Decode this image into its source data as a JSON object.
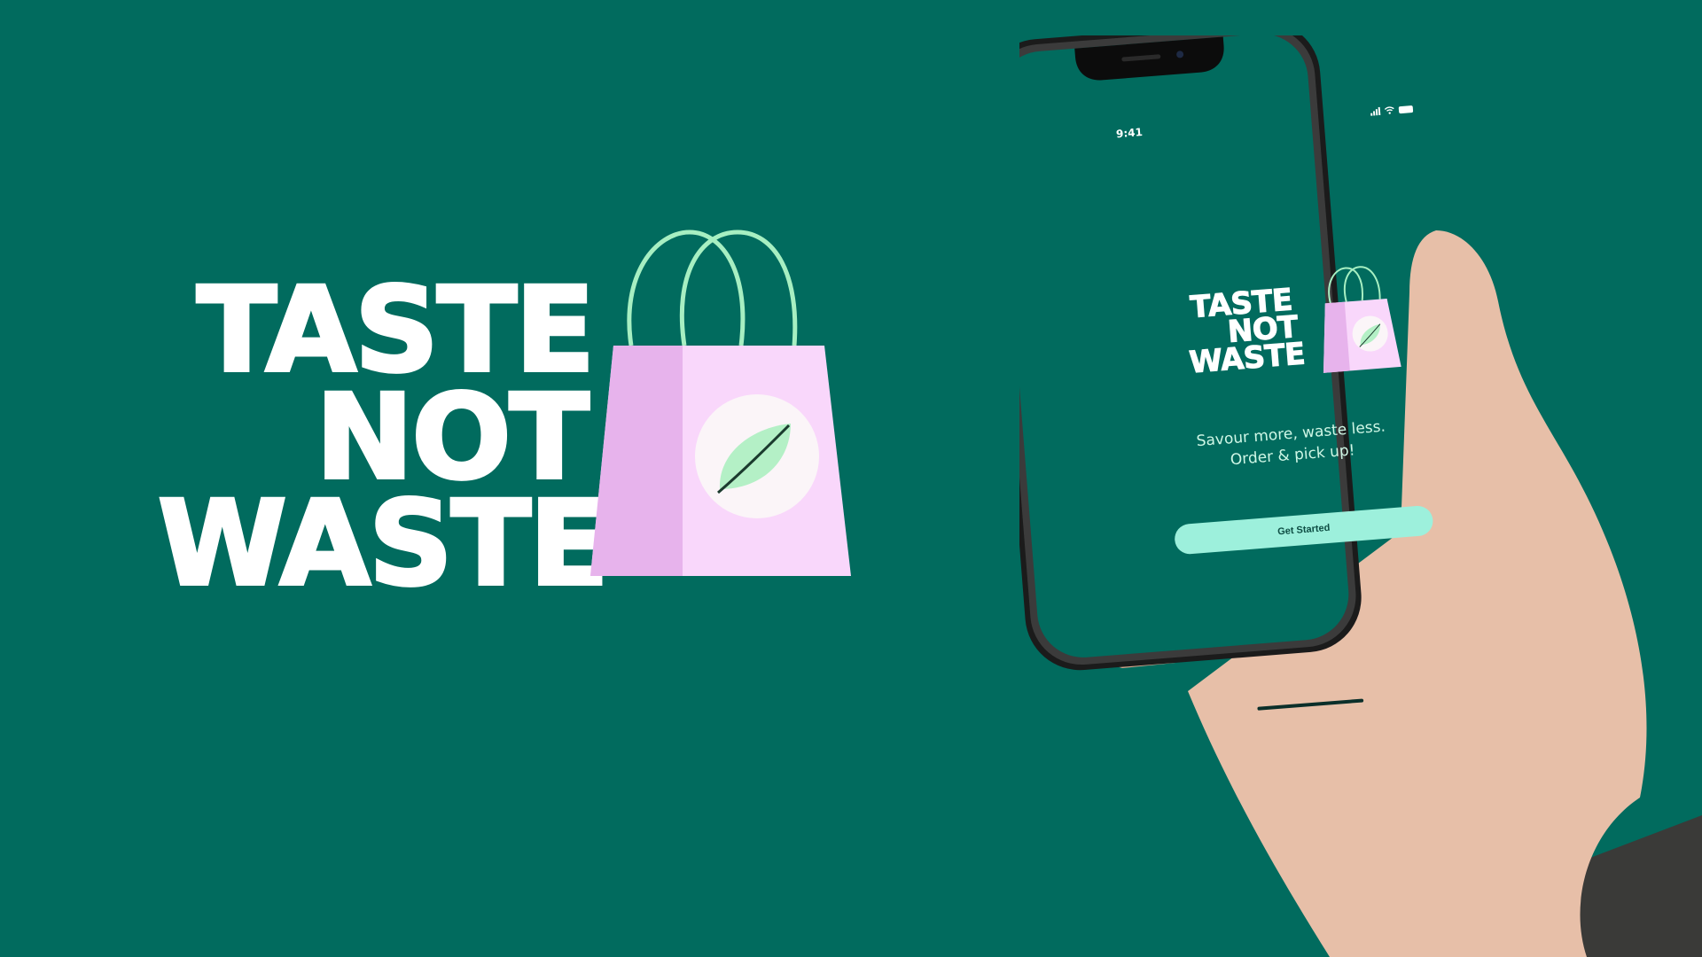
{
  "brand": {
    "words": [
      "TASTE",
      "NOT",
      "WASTE"
    ]
  },
  "phone": {
    "status_time": "9:41",
    "logo_words": [
      "TASTE",
      "NOT",
      "WASTE"
    ],
    "tagline_line1": "Savour more, waste less.",
    "tagline_line2": "Order & pick up!",
    "cta_label": "Get Started"
  },
  "colors": {
    "background": "#016B5E",
    "bag_pink": "#F9D7FB",
    "bag_side": "#E7B3EC",
    "handle_green": "#A7EFC2",
    "leaf_green": "#B4F0C6",
    "button": "#9DF0DC",
    "text_white": "#FFFFFF"
  },
  "icons": {
    "bag": "shopping-bag-icon",
    "leaf": "leaf-icon",
    "signal": "signal-icon",
    "wifi": "wifi-icon",
    "battery": "battery-icon"
  }
}
